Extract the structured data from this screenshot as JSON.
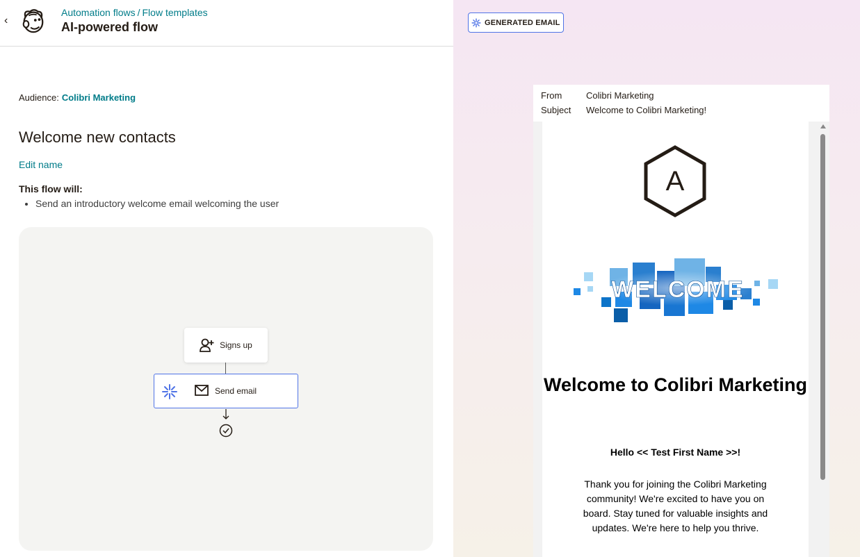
{
  "header": {
    "breadcrumb_1": "Automation flows",
    "breadcrumb_sep": "/",
    "breadcrumb_2": "Flow templates",
    "title": "AI-powered flow"
  },
  "audience": {
    "label": "Audience:",
    "value": "Colibri Marketing"
  },
  "flow": {
    "name": "Welcome new contacts",
    "edit_label": "Edit name",
    "will_label": "This flow will:",
    "steps": [
      "Send an introductory welcome email welcoming the user"
    ]
  },
  "diagram": {
    "trigger_label": "Signs up",
    "action_label": "Send email"
  },
  "preview": {
    "badge_label": "GENERATED EMAIL",
    "from_label": "From",
    "from_value": "Colibri Marketing",
    "subject_label": "Subject",
    "subject_value": "Welcome to Colibri Marketing!",
    "logo_letter": "A",
    "banner_text": "WELCOME",
    "heading": "Welcome to Colibri Marketing",
    "greeting": "Hello << Test First Name >>!",
    "body": "Thank you for joining the Colibri Marketing community! We're excited to have you on board. Stay tuned for valuable insights and updates. We're here to help you thrive."
  },
  "colors": {
    "link": "#007c89",
    "ai_accent": "#4f73e6",
    "canvas_bg": "#f4f4f2"
  }
}
